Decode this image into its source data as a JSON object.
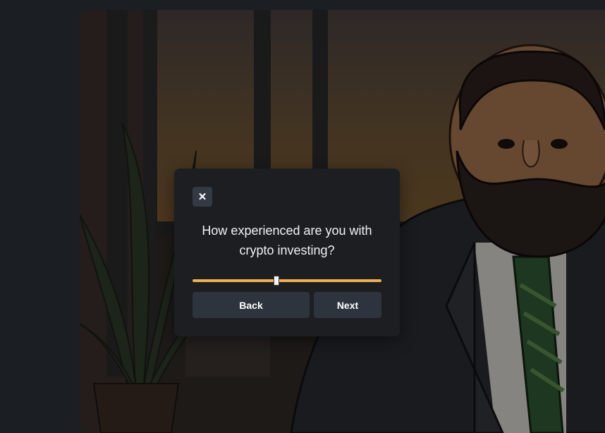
{
  "background": {
    "illustration_icon": "office-man-illustration"
  },
  "modal": {
    "close_icon": "close-icon",
    "close_glyph": "✕",
    "question": "How experienced are you with crypto investing?",
    "slider": {
      "value_fraction": 0.44,
      "accent_color": "#f0b04a"
    },
    "back_label": "Back",
    "next_label": "Next"
  },
  "colors": {
    "page_bg": "#1b1e22",
    "modal_bg": "#1c1e21",
    "button_bg": "#2e343d"
  }
}
